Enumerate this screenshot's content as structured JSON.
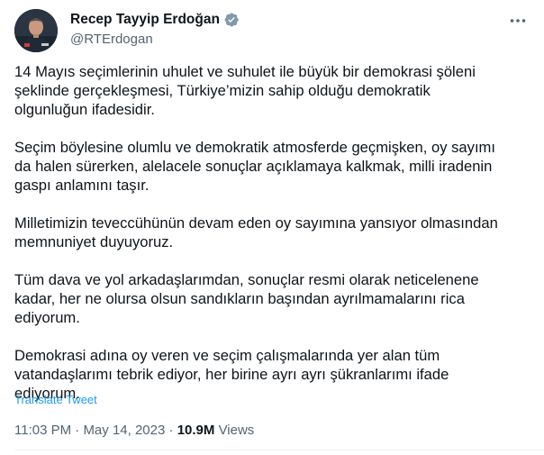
{
  "author": {
    "display_name": "Recep Tayyip Erdoğan",
    "handle": "@RTErdogan",
    "verified_icon": "verified-badge-icon",
    "badge_color": "#829aab"
  },
  "more_icon": "more-options-icon",
  "tweet": {
    "paragraphs": [
      "14 Mayıs seçimlerinin uhulet ve suhulet ile büyük bir demokrasi şöleni\nşeklinde gerçekleşmesi, Türkiye’mizin sahip olduğu demokratik\nolgunluğun ifadesidir.",
      "Seçim böylesine olumlu ve demokratik atmosferde geçmişken, oy sayımı\nda halen sürerken, alelacele sonuçlar açıklamaya kalkmak, milli iradenin\ngaspı anlamını taşır.",
      "Milletimizin teveccühünün devam eden oy sayımına yansıyor olmasından\nmemnuniyet duyuyoruz.",
      "Tüm dava ve yol arkadaşlarımdan, sonuçlar resmi olarak neticelenene\nkadar, her ne olursa olsun sandıkların başından ayrılmamalarını rica\nediyorum.",
      "Demokrasi adına oy veren ve seçim çalışmalarında yer alan tüm\nvatandaşlarımı tebrik ediyor, her birine ayrı ayrı şükranlarımı ifade\nediyorum."
    ],
    "translate_label": "Translate Tweet"
  },
  "meta": {
    "time": "11:03 PM",
    "separator": "·",
    "date": "May 14, 2023",
    "views_count": "10.9M",
    "views_label": "Views"
  },
  "colors": {
    "text": "#0f1419",
    "secondary": "#536471",
    "link": "#1d9bf0",
    "divider": "#eff3f4"
  }
}
